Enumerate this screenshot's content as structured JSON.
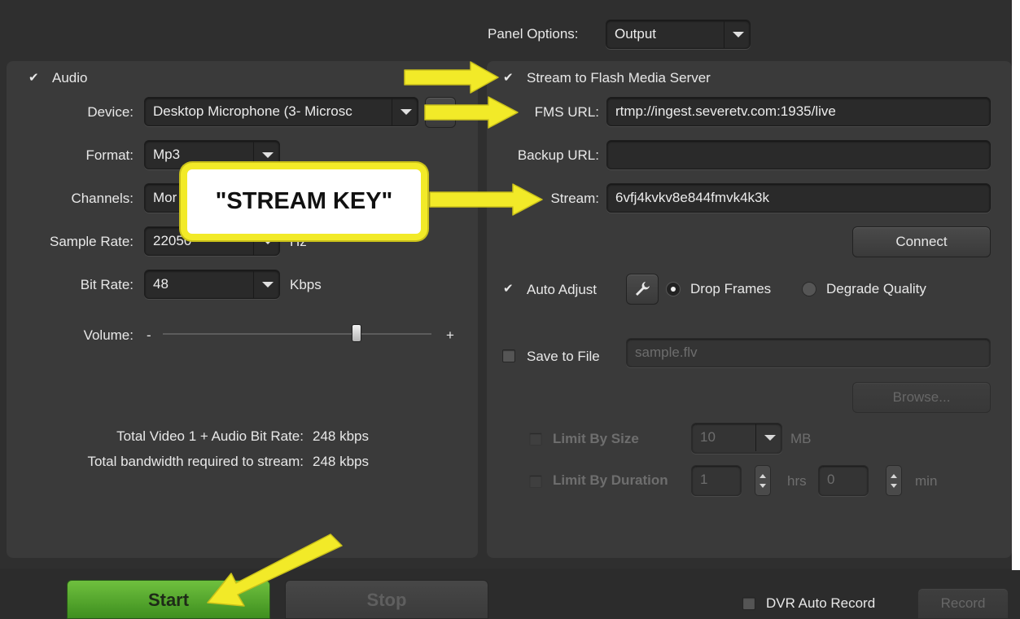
{
  "top": {
    "panel_options_label": "Panel Options:",
    "panel_options_value": "Output"
  },
  "audio": {
    "enabled_label": "Audio",
    "device_label": "Device:",
    "device_value": "Desktop Microphone (3- Microsc",
    "format_label": "Format:",
    "format_value": "Mp3",
    "channels_label": "Channels:",
    "channels_value": "Mor",
    "sample_rate_label": "Sample Rate:",
    "sample_rate_value": "22050",
    "sample_rate_unit": "Hz",
    "bit_rate_label": "Bit Rate:",
    "bit_rate_value": "48",
    "bit_rate_unit": "Kbps",
    "volume_label": "Volume:",
    "volume_min": "-",
    "volume_max": "+",
    "volume_level": 0.72,
    "total_bitrate_label": "Total Video 1 + Audio Bit Rate:",
    "total_bitrate_value": "248 kbps",
    "total_bandwidth_label": "Total bandwidth required to stream:",
    "total_bandwidth_value": "248 kbps"
  },
  "stream": {
    "enabled_label": "Stream to Flash Media Server",
    "fms_url_label": "FMS URL:",
    "fms_url_value": "rtmp://ingest.severetv.com:1935/live",
    "backup_url_label": "Backup URL:",
    "backup_url_value": "",
    "stream_label": "Stream:",
    "stream_value": "6vfj4kvkv8e844fmvk4k3k",
    "connect_label": "Connect",
    "auto_adjust_label": "Auto Adjust",
    "drop_frames_label": "Drop Frames",
    "degrade_quality_label": "Degrade Quality",
    "save_to_file_label": "Save to File",
    "save_file_placeholder": "sample.flv",
    "browse_label": "Browse...",
    "limit_size_label": "Limit By Size",
    "limit_size_value": "10",
    "limit_size_unit": "MB",
    "limit_duration_label": "Limit By Duration",
    "limit_hrs_value": "1",
    "hrs_unit": "hrs",
    "limit_min_value": "0",
    "min_unit": "min"
  },
  "callout_text": "\"STREAM KEY\"",
  "bottom": {
    "start_label": "Start",
    "stop_label": "Stop",
    "dvr_label": "DVR Auto Record",
    "record_label": "Record"
  },
  "colors": {
    "accent_green": "#4fa82a",
    "arrow_yellow": "#f2ea28",
    "panel_bg": "#3a3a3a"
  }
}
